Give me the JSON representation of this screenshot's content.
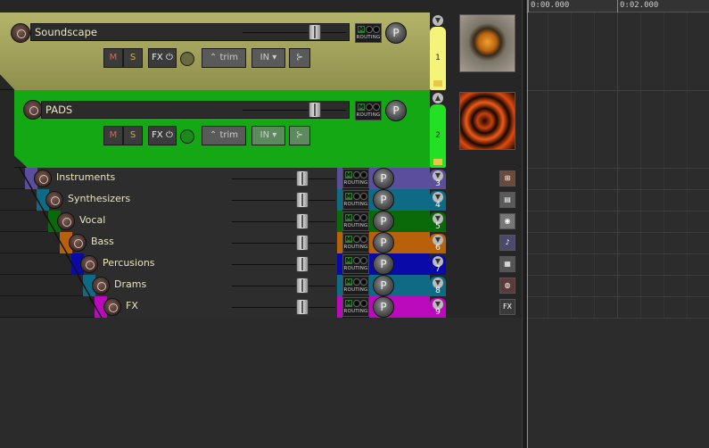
{
  "ruler": {
    "time_0": "0:00.000",
    "time_1": "0:02.000"
  },
  "folders": [
    {
      "name": "Soundscape",
      "number": "1",
      "color": "#a7a75f",
      "buttons": {
        "mute": "M",
        "solo": "S",
        "fx": "FX",
        "trim": "trim",
        "input": "IN"
      },
      "routing": "ROUTING",
      "pan": "P"
    },
    {
      "name": "PADS",
      "number": "2",
      "color": "#18a818",
      "buttons": {
        "mute": "M",
        "solo": "S",
        "fx": "FX",
        "trim": "trim",
        "input": "IN"
      },
      "routing": "ROUTING",
      "pan": "P"
    }
  ],
  "tracks": [
    {
      "name": "Instruments",
      "number": "3",
      "color": "#5b4e9d"
    },
    {
      "name": "Synthesizers",
      "number": "4",
      "color": "#0f6a86"
    },
    {
      "name": "Vocal",
      "number": "5",
      "color": "#0a6a0a"
    },
    {
      "name": "Bass",
      "number": "6",
      "color": "#b8610a"
    },
    {
      "name": "Percusions",
      "number": "7",
      "color": "#0a0aa8"
    },
    {
      "name": "Drams",
      "number": "8",
      "color": "#0f6a86"
    },
    {
      "name": "FX",
      "number": "9",
      "color": "#bb0abb"
    }
  ],
  "common": {
    "routing": "ROUTING",
    "pan": "P",
    "fx_icon": "FX"
  },
  "icons": {
    "folder_thumb_1": "orange-knob-image",
    "folder_thumb_2": "orange-abstract-image",
    "t3": "instrument-icon",
    "t4": "keyboard-icon",
    "t5": "microphone-icon",
    "t6": "guitar-icon",
    "t7": "rack-icon",
    "t8": "drum-icon",
    "t9": "fx-icon"
  }
}
